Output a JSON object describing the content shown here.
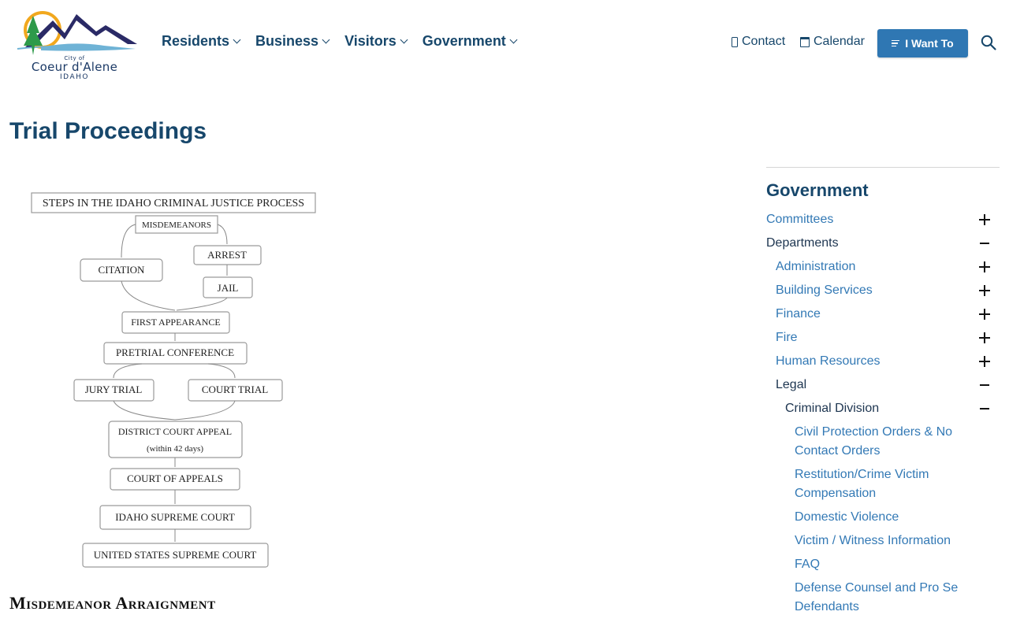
{
  "logo": {
    "small": "City of",
    "main": "Coeur d'Alene",
    "state": "IDAHO"
  },
  "nav": {
    "items": [
      {
        "label": "Residents"
      },
      {
        "label": "Business"
      },
      {
        "label": "Visitors"
      },
      {
        "label": "Government"
      }
    ]
  },
  "utility": {
    "contact": "Contact",
    "calendar": "Calendar",
    "i_want_to": "I Want To"
  },
  "page": {
    "title": "Trial Proceedings",
    "subheading": "Misdemeanor Arraignment"
  },
  "flowchart": {
    "title": "STEPS IN THE IDAHO CRIMINAL JUSTICE PROCESS",
    "misdemeanors": "MISDEMEANORS",
    "citation": "CITATION",
    "arrest": "ARREST",
    "jail": "JAIL",
    "first_appearance": "FIRST APPEARANCE",
    "pretrial_conference": "PRETRIAL CONFERENCE",
    "jury_trial": "JURY TRIAL",
    "court_trial": "COURT TRIAL",
    "district_court_appeal": "DISTRICT COURT APPEAL",
    "within_days": "(within 42 days)",
    "court_of_appeals": "COURT OF APPEALS",
    "idaho_supreme_court": "IDAHO SUPREME COURT",
    "us_supreme_court": "UNITED STATES SUPREME COURT"
  },
  "sidebar": {
    "title": "Government",
    "items": [
      {
        "label": "Committees",
        "level": 0,
        "state": "collapsed",
        "active": false
      },
      {
        "label": "Departments",
        "level": 0,
        "state": "expanded",
        "active": true
      },
      {
        "label": "Administration",
        "level": 1,
        "state": "collapsed",
        "active": false
      },
      {
        "label": "Building Services",
        "level": 1,
        "state": "collapsed",
        "active": false
      },
      {
        "label": "Finance",
        "level": 1,
        "state": "collapsed",
        "active": false
      },
      {
        "label": "Fire",
        "level": 1,
        "state": "collapsed",
        "active": false
      },
      {
        "label": "Human Resources",
        "level": 1,
        "state": "collapsed",
        "active": false
      },
      {
        "label": "Legal",
        "level": 1,
        "state": "expanded",
        "active": true
      },
      {
        "label": "Criminal Division",
        "level": 2,
        "state": "expanded",
        "active": true
      },
      {
        "label": "Civil Protection Orders & No Contact Orders",
        "level": 3,
        "state": "none",
        "active": false
      },
      {
        "label": "Restitution/Crime Victim Compensation",
        "level": 3,
        "state": "none",
        "active": false
      },
      {
        "label": "Domestic Violence",
        "level": 3,
        "state": "none",
        "active": false
      },
      {
        "label": "Victim / Witness Information",
        "level": 3,
        "state": "none",
        "active": false
      },
      {
        "label": "FAQ",
        "level": 3,
        "state": "none",
        "active": false
      },
      {
        "label": "Defense Counsel and Pro Se Defendants",
        "level": 3,
        "state": "none",
        "active": false
      }
    ]
  },
  "colors": {
    "brand_navy": "#17476b",
    "link_blue": "#3379b5",
    "button_blue": "#2f77b3"
  }
}
